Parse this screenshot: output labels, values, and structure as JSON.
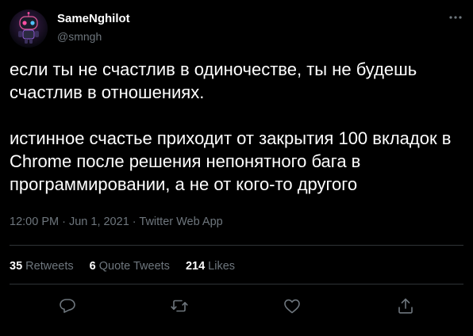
{
  "author": {
    "name": "SameNghilot",
    "handle": "@smngh"
  },
  "tweet": {
    "paragraph1": "если ты не счастлив в одиночестве, ты не будешь счастлив в отношениях.",
    "paragraph2": "истинное счастье приходит от закрытия 100 вкладок в Chrome после решения непонятного бага в программировании, а не от кого-то другого"
  },
  "meta": {
    "time": "12:00 PM",
    "separator1": " · ",
    "date": "Jun 1, 2021",
    "separator2": " · ",
    "source": "Twitter Web App"
  },
  "stats": {
    "retweets_count": "35",
    "retweets_label": "Retweets",
    "quotes_count": "6",
    "quotes_label": "Quote Tweets",
    "likes_count": "214",
    "likes_label": "Likes"
  },
  "actions": [
    "reply-icon",
    "retweet-icon",
    "like-icon",
    "share-icon"
  ],
  "colors": {
    "background": "#000000",
    "text": "#ffffff",
    "secondary": "#6e767d",
    "divider": "#2f3336"
  }
}
